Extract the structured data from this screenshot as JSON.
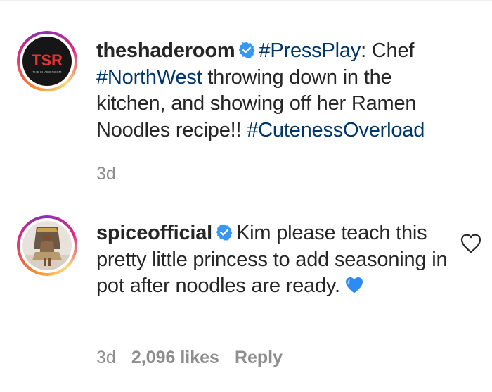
{
  "post_caption": {
    "username": "theshaderoom",
    "avatar_text": "TSR",
    "avatar_subtext": "THE SHADE ROOM",
    "segments": {
      "tag1": "#PressPlay",
      "text1": ": Chef ",
      "tag2": "#NorthWest",
      "text2": " throwing down in the kitchen, and showing off her Ramen Noodles recipe!! ",
      "tag3": "#CutenessOverload"
    },
    "timestamp": "3d"
  },
  "comment": {
    "username": "spiceofficial",
    "text": "Kim please teach this pretty little princess to add seasoning in pot after noodles are ready.",
    "emoji": "blue-heart",
    "timestamp": "3d",
    "likes": "2,096 likes",
    "reply_label": "Reply"
  },
  "colors": {
    "text": "#262626",
    "hashtag": "#00376b",
    "meta": "#8e8e8e",
    "verified": "#3897f0"
  }
}
